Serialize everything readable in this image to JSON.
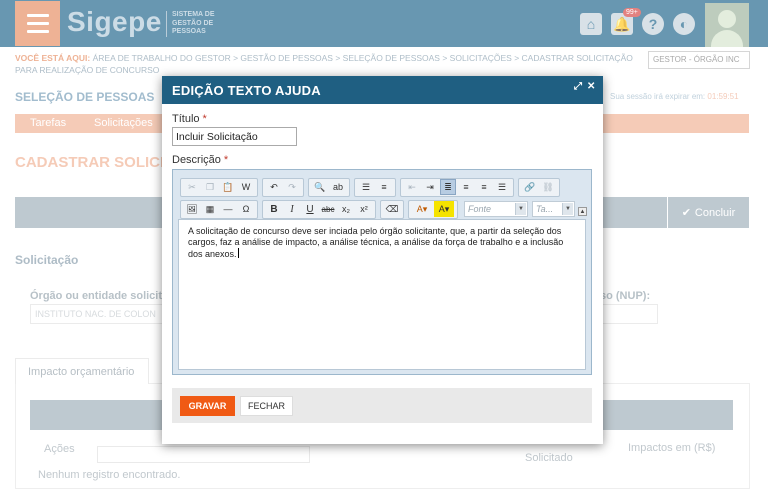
{
  "app": {
    "brand": "Sigepe",
    "brand_sub": "SISTEMA DE GESTÃO DE PESSOAS",
    "notif_count": "99+",
    "profile": "GESTOR - ÓRGÃO INC"
  },
  "breadcrumb": {
    "prefix": "VOCÊ ESTÁ AQUI:",
    "path": "ÁREA DE TRABALHO DO GESTOR > GESTÃO DE PESSOAS > SELEÇÃO DE PESSOAS > SOLICITAÇÕES > CADASTRAR SOLICITAÇÃO PARA REALIZAÇÃO DE CONCURSO"
  },
  "page": {
    "section_title": "SELEÇÃO DE PESSOAS",
    "session_label": "Sua sessão irá expirar em:",
    "session_time": "01:59:51",
    "nav": [
      "Tarefas",
      "Solicitações"
    ],
    "title": "CADASTRAR SOLICITA",
    "concluir": "Concluir",
    "subsection": "Solicitação",
    "orgao_label": "Órgão ou entidade solicitan",
    "orgao_value": "INSTITUTO NAC. DE COLON",
    "nup_label": "so (NUP):",
    "tab": "Impacto orçamentário",
    "col_acoes": "Ações",
    "col_solicitado": "Solicitado",
    "col_impactos": "Impactos em (R$)",
    "no_records": "Nenhum registro encontrado."
  },
  "modal": {
    "title": "EDIÇÃO TEXTO AJUDA",
    "titulo_label": "Título",
    "required_mark": "*",
    "titulo_value": "Incluir Solicitação",
    "descricao_label": "Descrição",
    "fonte_placeholder": "Fonte",
    "tamanho_placeholder": "Ta...",
    "body_text": "A solicitação de concurso deve ser inciada pelo órgão solicitante, que, a partir da seleção dos cargos, faz a análise de impacto, a análise técnica, a análise da força de trabalho e a inclusão dos anexos.",
    "gravar": "GRAVAR",
    "fechar": "FECHAR"
  }
}
